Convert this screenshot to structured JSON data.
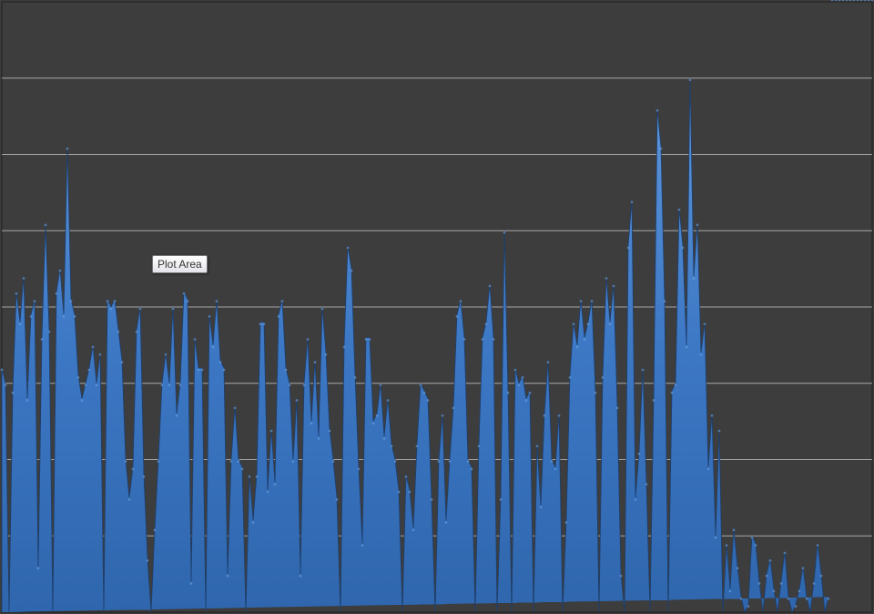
{
  "tooltip": {
    "label": "Plot Area"
  },
  "colors": {
    "plot_background": "#3d3d3d",
    "gridline": "#a8a8a8",
    "area_fill": "#3d78c5",
    "area_highlight": "#6fa5e3",
    "area_shadow": "#1d3f6e"
  },
  "chart_data": {
    "type": "area",
    "title": "",
    "xlabel": "",
    "ylabel": "",
    "ylim": [
      0,
      8
    ],
    "grid": true,
    "legend": "none",
    "gridline_values": [
      1,
      2,
      3,
      4,
      5,
      6,
      7
    ],
    "x": [
      0,
      1,
      2,
      3,
      4,
      5,
      6,
      7,
      8,
      9,
      10,
      11,
      12,
      13,
      14,
      15,
      16,
      17,
      18,
      19,
      20,
      21,
      22,
      23,
      24,
      25,
      26,
      27,
      28,
      29,
      30,
      31,
      32,
      33,
      34,
      35,
      36,
      37,
      38,
      39,
      40,
      41,
      42,
      43,
      44,
      45,
      46,
      47,
      48,
      49,
      50,
      51,
      52,
      53,
      54,
      55,
      56,
      57,
      58,
      59,
      60,
      61,
      62,
      63,
      64,
      65,
      66,
      67,
      68,
      69,
      70,
      71,
      72,
      73,
      74,
      75,
      76,
      77,
      78,
      79,
      80,
      81,
      82,
      83,
      84,
      85,
      86,
      87,
      88,
      89,
      90,
      91,
      92,
      93,
      94,
      95,
      96,
      97,
      98,
      99,
      100,
      101,
      102,
      103,
      104,
      105,
      106,
      107,
      108,
      109,
      110,
      111,
      112,
      113,
      114,
      115,
      116,
      117,
      118,
      119,
      120,
      121,
      122,
      123,
      124,
      125,
      126,
      127,
      128,
      129,
      130,
      131,
      132,
      133,
      134,
      135,
      136,
      137,
      138,
      139,
      140,
      141,
      142,
      143,
      144,
      145,
      146,
      147,
      148,
      149,
      150,
      151,
      152,
      153,
      154,
      155,
      156,
      157,
      158,
      159,
      160,
      161,
      162,
      163,
      164,
      165,
      166,
      167,
      168,
      169,
      170,
      171,
      172,
      173,
      174,
      175,
      176,
      177,
      178,
      179,
      180,
      181,
      182,
      183,
      184,
      185,
      186,
      187,
      188,
      189,
      190,
      191,
      192,
      193,
      194,
      195,
      196,
      197,
      198,
      199,
      200,
      201,
      202,
      203,
      204,
      205,
      206,
      207,
      208,
      209,
      210,
      211,
      212,
      213,
      214,
      215,
      216,
      217,
      218,
      219,
      220,
      221,
      222,
      223,
      224,
      225,
      226,
      227,
      228,
      229,
      230,
      231,
      232,
      233,
      234,
      235,
      236,
      237,
      238,
      239
    ],
    "series": [
      {
        "values": [
          3.2,
          3.0,
          0.0,
          2.9,
          4.2,
          3.8,
          4.4,
          2.8,
          3.9,
          4.1,
          0.6,
          3.6,
          5.1,
          3.7,
          0.0,
          4.2,
          4.5,
          3.9,
          6.1,
          4.1,
          3.9,
          3.1,
          2.8,
          3.0,
          3.2,
          3.5,
          3.0,
          3.4,
          0.0,
          4.1,
          4.0,
          4.1,
          3.7,
          3.3,
          2.0,
          1.5,
          1.9,
          3.7,
          4.0,
          1.8,
          0.7,
          0.0,
          1.1,
          2.0,
          3.0,
          3.4,
          3.0,
          4.0,
          2.6,
          3.0,
          4.2,
          4.1,
          0.4,
          3.6,
          3.2,
          3.2,
          0.0,
          3.9,
          3.5,
          4.1,
          3.3,
          3.2,
          0.5,
          2.0,
          2.7,
          2.0,
          1.9,
          0.0,
          1.8,
          1.2,
          1.8,
          3.8,
          3.8,
          1.6,
          2.4,
          1.7,
          3.9,
          4.1,
          3.2,
          3.0,
          2.0,
          2.8,
          0.5,
          3.0,
          3.6,
          2.5,
          3.3,
          2.3,
          4.0,
          3.4,
          2.4,
          2.0,
          1.5,
          0.0,
          3.5,
          4.8,
          4.5,
          3.1,
          1.9,
          0.9,
          3.6,
          3.6,
          2.5,
          2.6,
          3.0,
          2.3,
          2.8,
          2.2,
          2.0,
          1.6,
          0.0,
          1.8,
          1.6,
          1.1,
          2.2,
          3.0,
          2.9,
          2.8,
          1.5,
          0.0,
          2.0,
          2.6,
          1.2,
          2.0,
          2.7,
          3.9,
          4.1,
          3.6,
          2.0,
          1.9,
          0.0,
          2.2,
          3.6,
          3.8,
          4.3,
          3.6,
          0.0,
          1.5,
          5.0,
          2.9,
          0.0,
          3.2,
          3.0,
          3.1,
          2.8,
          2.9,
          0.0,
          2.2,
          1.4,
          2.6,
          3.3,
          2.0,
          1.9,
          2.6,
          0.0,
          1.2,
          3.1,
          3.8,
          3.5,
          4.1,
          3.6,
          3.8,
          4.1,
          2.9,
          0.0,
          3.1,
          4.4,
          3.8,
          4.3,
          2.7,
          0.5,
          0.0,
          4.8,
          5.4,
          1.5,
          2.1,
          3.2,
          1.7,
          0.0,
          2.8,
          6.6,
          6.1,
          4.1,
          0.0,
          2.9,
          3.0,
          5.3,
          4.8,
          3.5,
          7.0,
          4.4,
          5.1,
          3.4,
          3.8,
          1.9,
          2.6,
          1.0,
          2.4,
          0.0,
          0.9,
          0.3,
          1.1,
          0.6,
          0.2,
          0.0,
          0.1,
          1.0,
          0.9,
          0.4,
          0.0,
          0.5,
          0.7,
          0.3,
          0.0,
          0.4,
          0.8,
          0.2,
          0.0,
          0.1,
          0.3,
          0.6,
          0.2,
          0.0,
          0.4,
          0.9,
          0.5,
          0.0,
          0.2
        ]
      }
    ]
  }
}
